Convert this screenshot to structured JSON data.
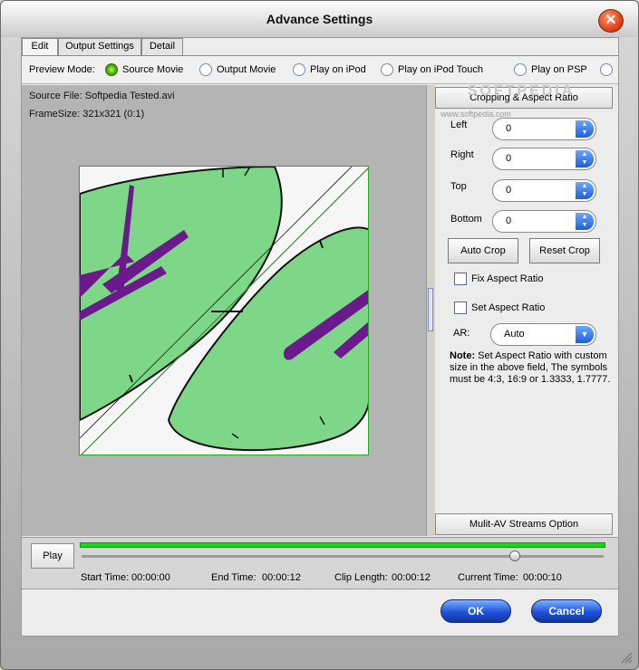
{
  "window": {
    "title": "Advance Settings"
  },
  "tabs": [
    {
      "label": "Edit"
    },
    {
      "label": "Output Settings"
    },
    {
      "label": "Detail"
    }
  ],
  "preview_mode": {
    "label": "Preview Mode:",
    "options": [
      {
        "label": "Source Movie",
        "selected": true
      },
      {
        "label": "Output Movie",
        "selected": false
      },
      {
        "label": "Play on iPod",
        "selected": false
      },
      {
        "label": "Play on iPod Touch",
        "selected": false
      },
      {
        "label": "Play on PSP",
        "selected": false
      }
    ]
  },
  "preview": {
    "source_file": "Source File: Softpedia Tested.avi",
    "frame_size": "FrameSize: 321x321 (0:1)"
  },
  "crop_panel": {
    "header": "Cropping & Aspect Ratio",
    "left_label": "Left",
    "left_value": "0",
    "right_label": "Right",
    "right_value": "0",
    "top_label": "Top",
    "top_value": "0",
    "bottom_label": "Bottom",
    "bottom_value": "0",
    "auto_crop": "Auto Crop",
    "reset_crop": "Reset Crop",
    "fix_aspect": "Fix Aspect Ratio",
    "set_aspect": "Set Aspect Ratio",
    "ar_label": "AR:",
    "ar_value": "Auto",
    "note_bold": "Note:",
    "note_text": " Set Aspect Ratio with custom size in the above field, The symbols must be 4:3, 16:9 or 1.3333, 1.7777.",
    "multi_av": "Mulit-AV Streams Option"
  },
  "playback": {
    "play": "Play",
    "start_label": "Start Time:",
    "start_value": "00:00:00",
    "end_label": "End Time:",
    "end_value": "00:00:12",
    "clip_label": "Clip Length:",
    "clip_value": "00:00:12",
    "current_label": "Current Time:",
    "current_value": "00:00:10",
    "position_fraction": 0.83
  },
  "footer": {
    "ok": "OK",
    "cancel": "Cancel"
  },
  "watermark": {
    "brand": "SOFTPEDIA",
    "url": "www.softpedia.com"
  },
  "colors": {
    "accent_blue": "#1f52d8",
    "progress_green": "#1fd01f",
    "video_green": "#7ed688",
    "video_purple": "#6a1a8a"
  }
}
